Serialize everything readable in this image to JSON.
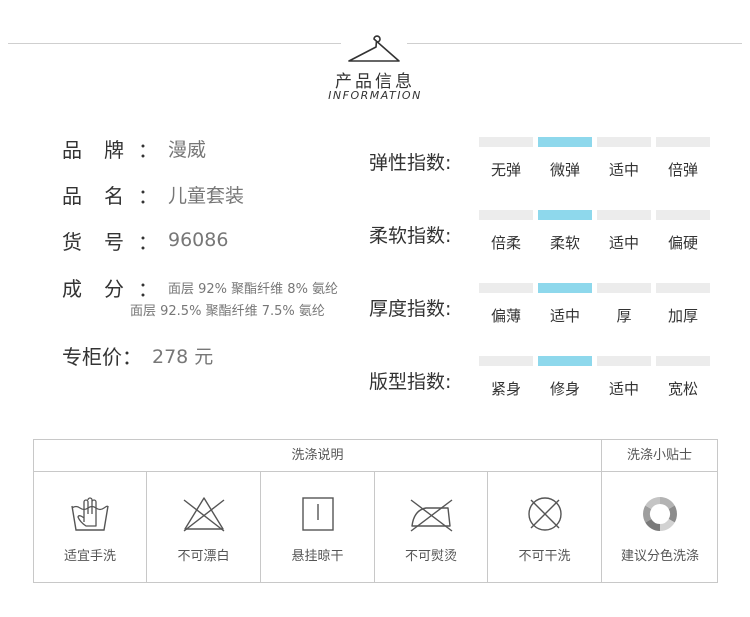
{
  "header": {
    "title_cn": "产品信息",
    "title_en": "INFORMATION"
  },
  "info": {
    "brand": {
      "label": "品牌",
      "value": "漫威"
    },
    "name": {
      "label": "品名",
      "value": "儿童套装"
    },
    "item_no": {
      "label": "货号",
      "value": "96086"
    },
    "composition": {
      "label": "成分",
      "line1": "面层 92% 聚酯纤维 8% 氨纶",
      "line2": "面层 92.5% 聚酯纤维 7.5% 氨纶"
    },
    "price": {
      "label": "专柜价",
      "value": "278 元"
    },
    "colon": "："
  },
  "indices": [
    {
      "label": "弹性指数:",
      "options": [
        "无弹",
        "微弹",
        "适中",
        "倍弹"
      ],
      "selected": 1
    },
    {
      "label": "柔软指数:",
      "options": [
        "倍柔",
        "柔软",
        "适中",
        "偏硬"
      ],
      "selected": 1
    },
    {
      "label": "厚度指数:",
      "options": [
        "偏薄",
        "适中",
        "厚",
        "加厚"
      ],
      "selected": 1
    },
    {
      "label": "版型指数:",
      "options": [
        "紧身",
        "修身",
        "适中",
        "宽松"
      ],
      "selected": 1
    }
  ],
  "care": {
    "title": "洗涤说明",
    "tips_title": "洗涤小贴士",
    "items": [
      {
        "label": "适宜手洗",
        "icon": "hand-wash-icon"
      },
      {
        "label": "不可漂白",
        "icon": "no-bleach-icon"
      },
      {
        "label": "悬挂晾干",
        "icon": "hang-dry-icon"
      },
      {
        "label": "不可熨烫",
        "icon": "no-iron-icon"
      },
      {
        "label": "不可干洗",
        "icon": "no-dry-clean-icon"
      }
    ],
    "tip": {
      "label": "建议分色洗涤",
      "icon": "color-separate-icon"
    }
  },
  "colors": {
    "accent": "#8ed8ec",
    "bar_inactive": "#ececec",
    "text": "#333333",
    "muted": "#777777",
    "line": "#c8c8c8"
  }
}
